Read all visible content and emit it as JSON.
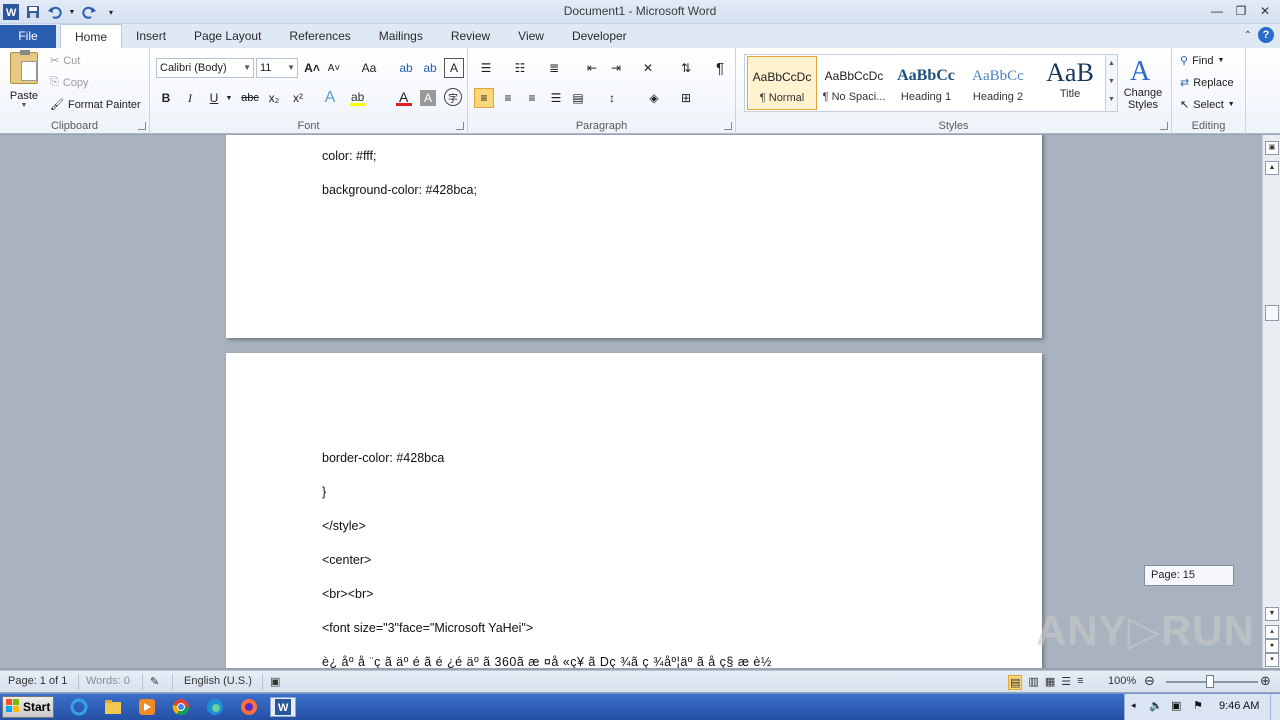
{
  "window": {
    "title": "Document1  -  Microsoft Word"
  },
  "tabs": {
    "file": "File",
    "items": [
      "Home",
      "Insert",
      "Page Layout",
      "References",
      "Mailings",
      "Review",
      "View",
      "Developer"
    ],
    "active": "Home"
  },
  "clipboard": {
    "paste": "Paste",
    "cut": "Cut",
    "copy": "Copy",
    "format_painter": "Format Painter",
    "label": "Clipboard"
  },
  "font": {
    "family": "Calibri (Body)",
    "size": "11",
    "label": "Font",
    "bold": "B",
    "italic": "I",
    "underline": "U",
    "strike": "abc",
    "subscript": "x₂",
    "superscript": "x²",
    "grow": "A˄",
    "shrink": "A˅",
    "change_case": "Aa"
  },
  "paragraph": {
    "label": "Paragraph",
    "pilcrow": "¶"
  },
  "styles": {
    "label": "Styles",
    "items": [
      {
        "sample": "AaBbCcDc",
        "name": "¶ Normal"
      },
      {
        "sample": "AaBbCcDc",
        "name": "¶ No Spaci..."
      },
      {
        "sample": "AaBbCc",
        "name": "Heading 1"
      },
      {
        "sample": "AaBbCc",
        "name": "Heading 2"
      },
      {
        "sample": "AaB",
        "name": "Title"
      }
    ],
    "change_styles": "Change Styles"
  },
  "editing": {
    "label": "Editing",
    "find": "Find",
    "replace": "Replace",
    "select": "Select"
  },
  "document": {
    "page1_lines": [
      "color: #fff;",
      "background-color: #428bca;"
    ],
    "page2_lines": [
      "border-color: #428bca",
      "}",
      "</style>",
      "<center>",
      "<br><br>",
      "<font size=\"3\"face=\"Microsoft YaHei\">",
      "è¿  åº  å ¨ç   ã    äº  é    ã     é  ¿é    äº  ã     360ã     æ  ¤å  «ç¥  ã     Dç ¾ã     ç  ¾åº¦äº  ã     å     ç§  æ     è½"
    ]
  },
  "page_tip": "Page: 15",
  "watermark": "ANY▷RUN",
  "status": {
    "page": "Page: 1 of 1",
    "words": "Words: 0",
    "language": "English (U.S.)",
    "zoom": "100%",
    "zoom_level": 1.0
  },
  "taskbar": {
    "start": "Start",
    "clock": "9:46 AM"
  }
}
